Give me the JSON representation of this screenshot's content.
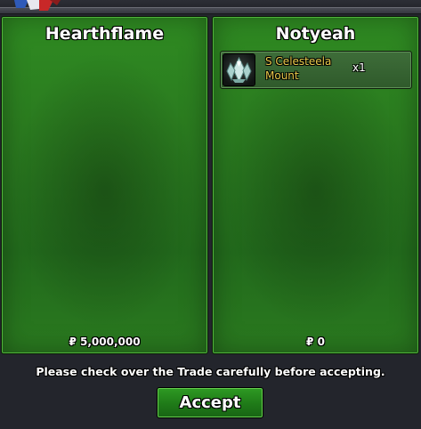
{
  "left_panel": {
    "player_name": "Hearthflame",
    "money": "₽ 5,000,000"
  },
  "right_panel": {
    "player_name": "Notyeah",
    "money": "₽ 0",
    "items": [
      {
        "name": "S Celesteela Mount",
        "quantity": "x1",
        "icon": "celesteela-icon"
      }
    ]
  },
  "notice": "Please check over the Trade carefully before accepting.",
  "accept_label": "Accept",
  "colors": {
    "panel_green": "#2a7a1f",
    "item_name": "#e8c84a",
    "background": "#23252c"
  }
}
